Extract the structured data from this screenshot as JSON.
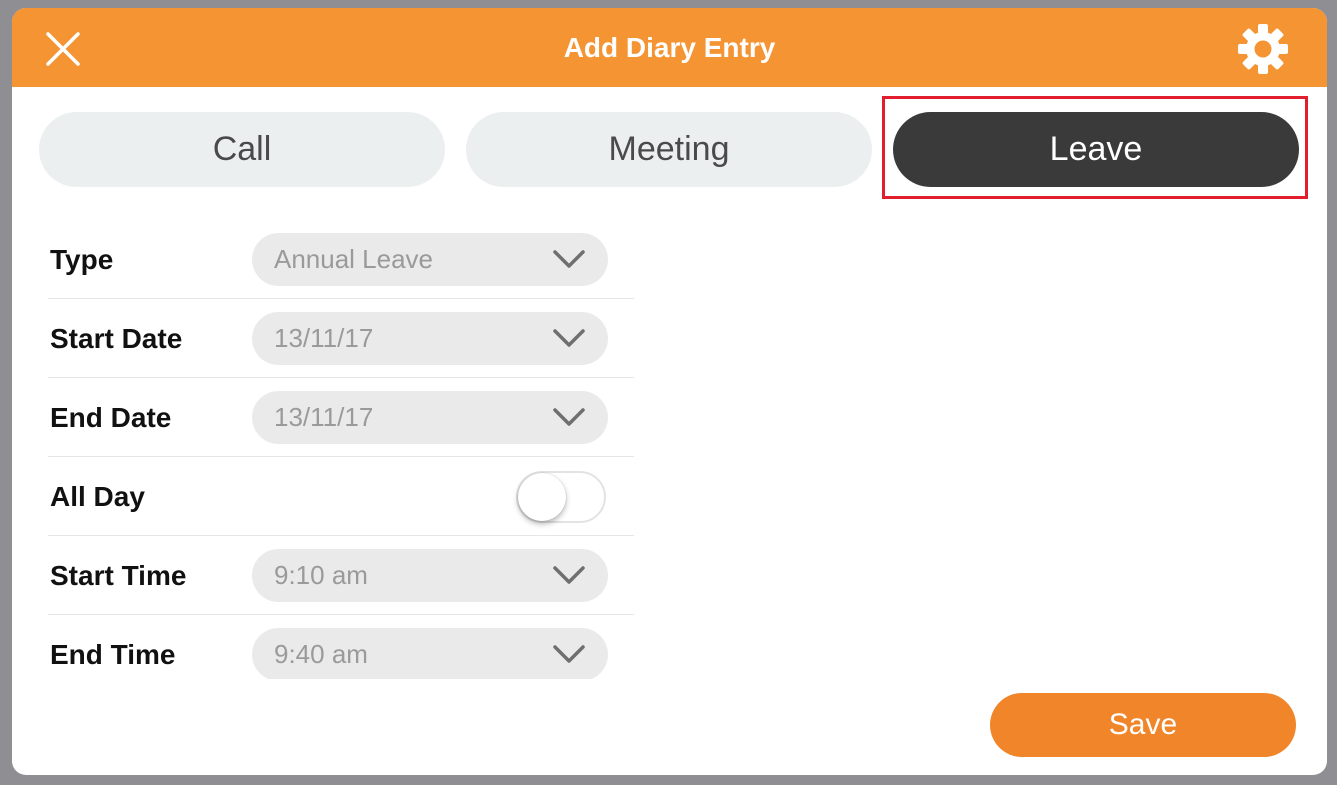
{
  "header": {
    "title": "Add Diary Entry",
    "close_icon": "close-icon",
    "settings_icon": "gear-icon",
    "color": "#f59432"
  },
  "segments": [
    {
      "label": "Call",
      "active": false
    },
    {
      "label": "Meeting",
      "active": false
    },
    {
      "label": "Leave",
      "active": true
    }
  ],
  "form": {
    "type": {
      "label": "Type",
      "value": "Annual Leave"
    },
    "start_date": {
      "label": "Start Date",
      "value": "13/11/17"
    },
    "end_date": {
      "label": "End Date",
      "value": "13/11/17"
    },
    "all_day": {
      "label": "All Day",
      "on": false
    },
    "start_time": {
      "label": "Start Time",
      "value": "9:10 am"
    },
    "end_time": {
      "label": "End Time",
      "value": "9:40 am"
    }
  },
  "save_label": "Save",
  "colors": {
    "accent": "#f59432",
    "save": "#f0852a",
    "active_segment": "#3a3a3a",
    "highlight": "#e01e2d"
  }
}
